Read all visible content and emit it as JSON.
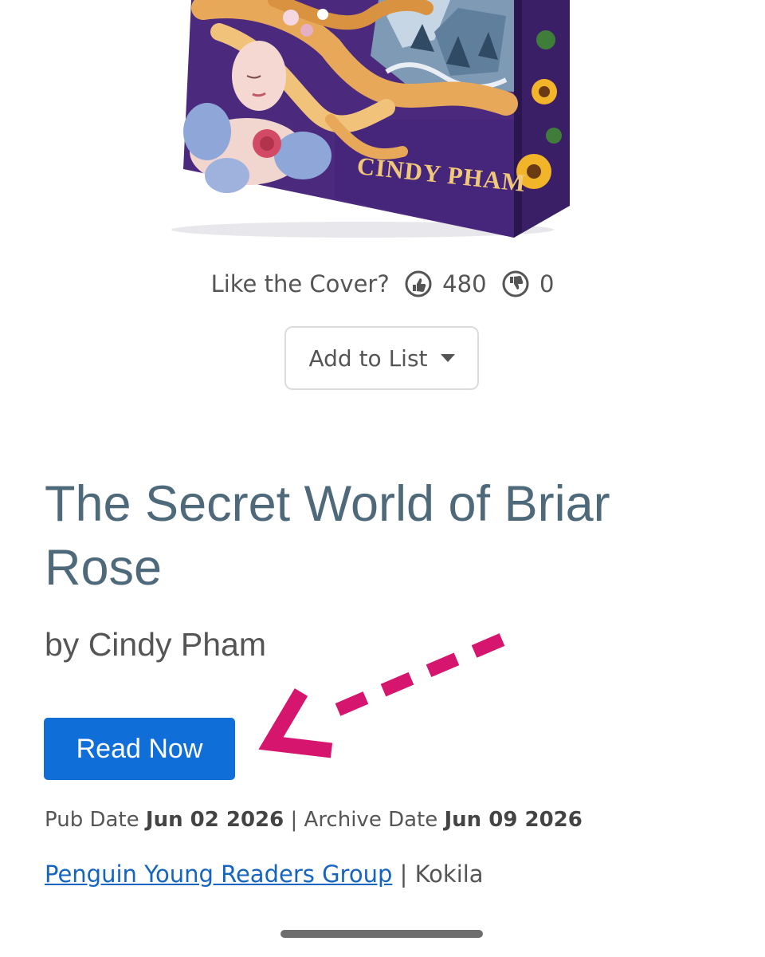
{
  "book": {
    "cover_author_text": "CINDY PHAM",
    "title": "The Secret World of Briar Rose",
    "byline": "by Cindy Pham"
  },
  "cover_feedback": {
    "prompt": "Like the Cover?",
    "likes": "480",
    "dislikes": "0",
    "like_icon": "thumbs-up-icon",
    "dislike_icon": "thumbs-down-icon"
  },
  "add_to_list": {
    "label": "Add to List",
    "icon": "caret-down-icon"
  },
  "read_now": {
    "label": "Read Now",
    "color": "#0f6ed8"
  },
  "dates": {
    "pub_label": "Pub Date",
    "pub_value": "Jun 02 2026",
    "separator": "|",
    "archive_label": "Archive Date",
    "archive_value": "Jun 09 2026"
  },
  "publisher": {
    "name": "Penguin Young Readers Group",
    "separator": "|",
    "imprint": "Kokila"
  },
  "colors": {
    "title": "#4e6979",
    "link": "#1565c0",
    "annotation_arrow": "#d6156f",
    "cover_purple": "#4b2a7e"
  }
}
